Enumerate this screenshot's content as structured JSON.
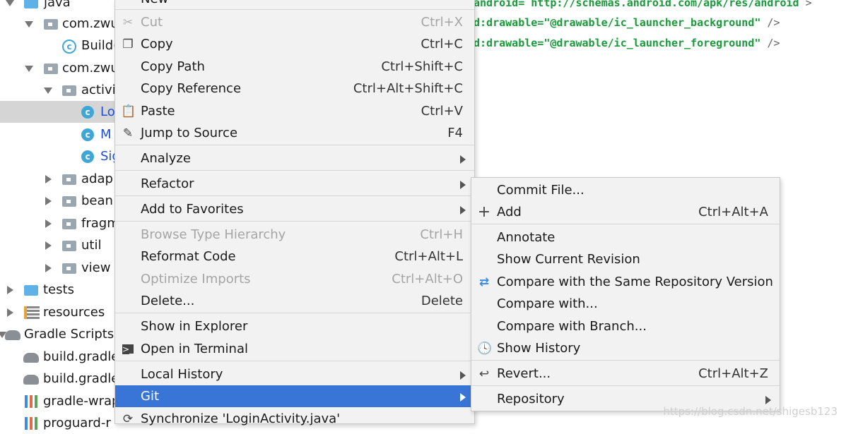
{
  "tree": {
    "rows": [
      {
        "label": "java"
      },
      {
        "label": "com.zwu"
      },
      {
        "label": "Build("
      },
      {
        "label": "com.zwu"
      },
      {
        "label": "activi"
      },
      {
        "label": "Lo"
      },
      {
        "label": "M"
      },
      {
        "label": "Sig"
      },
      {
        "label": "adap"
      },
      {
        "label": "bean"
      },
      {
        "label": "fragm"
      },
      {
        "label": "util"
      },
      {
        "label": "view"
      },
      {
        "label": "tests"
      },
      {
        "label": "resources"
      },
      {
        "label": "Gradle Scripts"
      },
      {
        "label": "build.gradle"
      },
      {
        "label": "build.gradle"
      },
      {
        "label": "gradle-wrap"
      },
      {
        "label": "proguard-r"
      }
    ]
  },
  "editor": {
    "lines": [
      {
        "attr": "android= http://schemas.android.com/apk/res/android",
        "str": "",
        "tail": " >"
      },
      {
        "attr": "d:drawable=",
        "str": "\"@drawable/ic_launcher_background\"",
        "tail": " />"
      },
      {
        "attr": "d:drawable=",
        "str": "\"@drawable/ic_launcher_foreground\"",
        "tail": " />"
      }
    ]
  },
  "context_menu": {
    "top_partial": "New",
    "items": {
      "cut": {
        "label": "Cut",
        "shortcut": "Ctrl+X"
      },
      "copy": {
        "label": "Copy",
        "shortcut": "Ctrl+C"
      },
      "copy_path": {
        "label": "Copy Path",
        "shortcut": "Ctrl+Shift+C"
      },
      "copy_reference": {
        "label": "Copy Reference",
        "shortcut": "Ctrl+Alt+Shift+C"
      },
      "paste": {
        "label": "Paste",
        "shortcut": "Ctrl+V"
      },
      "jump_to_source": {
        "label": "Jump to Source",
        "shortcut": "F4"
      },
      "analyze": {
        "label": "Analyze"
      },
      "refactor": {
        "label": "Refactor"
      },
      "add_to_favorites": {
        "label": "Add to Favorites"
      },
      "browse_type_hierarchy": {
        "label": "Browse Type Hierarchy",
        "shortcut": "Ctrl+H"
      },
      "reformat_code": {
        "label": "Reformat Code",
        "shortcut": "Ctrl+Alt+L"
      },
      "optimize_imports": {
        "label": "Optimize Imports",
        "shortcut": "Ctrl+Alt+O"
      },
      "delete": {
        "label": "Delete...",
        "shortcut": "Delete"
      },
      "show_in_explorer": {
        "label": "Show in Explorer"
      },
      "open_in_terminal": {
        "label": "Open in Terminal"
      },
      "local_history": {
        "label": "Local History"
      },
      "git": {
        "label": "Git"
      },
      "synchronize": {
        "label": "Synchronize 'LoginActivity.java'"
      }
    }
  },
  "git_submenu": {
    "items": {
      "commit_file": {
        "label": "Commit File..."
      },
      "add": {
        "label": "Add",
        "shortcut": "Ctrl+Alt+A"
      },
      "annotate": {
        "label": "Annotate"
      },
      "show_current_revision": {
        "label": "Show Current Revision"
      },
      "compare_same_repo": {
        "label": "Compare with the Same Repository Version"
      },
      "compare_with": {
        "label": "Compare with..."
      },
      "compare_with_branch": {
        "label": "Compare with Branch..."
      },
      "show_history": {
        "label": "Show History"
      },
      "revert": {
        "label": "Revert...",
        "shortcut": "Ctrl+Alt+Z"
      },
      "repository": {
        "label": "Repository"
      }
    }
  },
  "watermark": "https://blog.csdn.net/shigesb123",
  "colors": {
    "highlight": "#3875d7",
    "menu_bg": "#f2f2f2",
    "disabled": "#a5a5a5",
    "code_green": "#1a9a3a"
  }
}
